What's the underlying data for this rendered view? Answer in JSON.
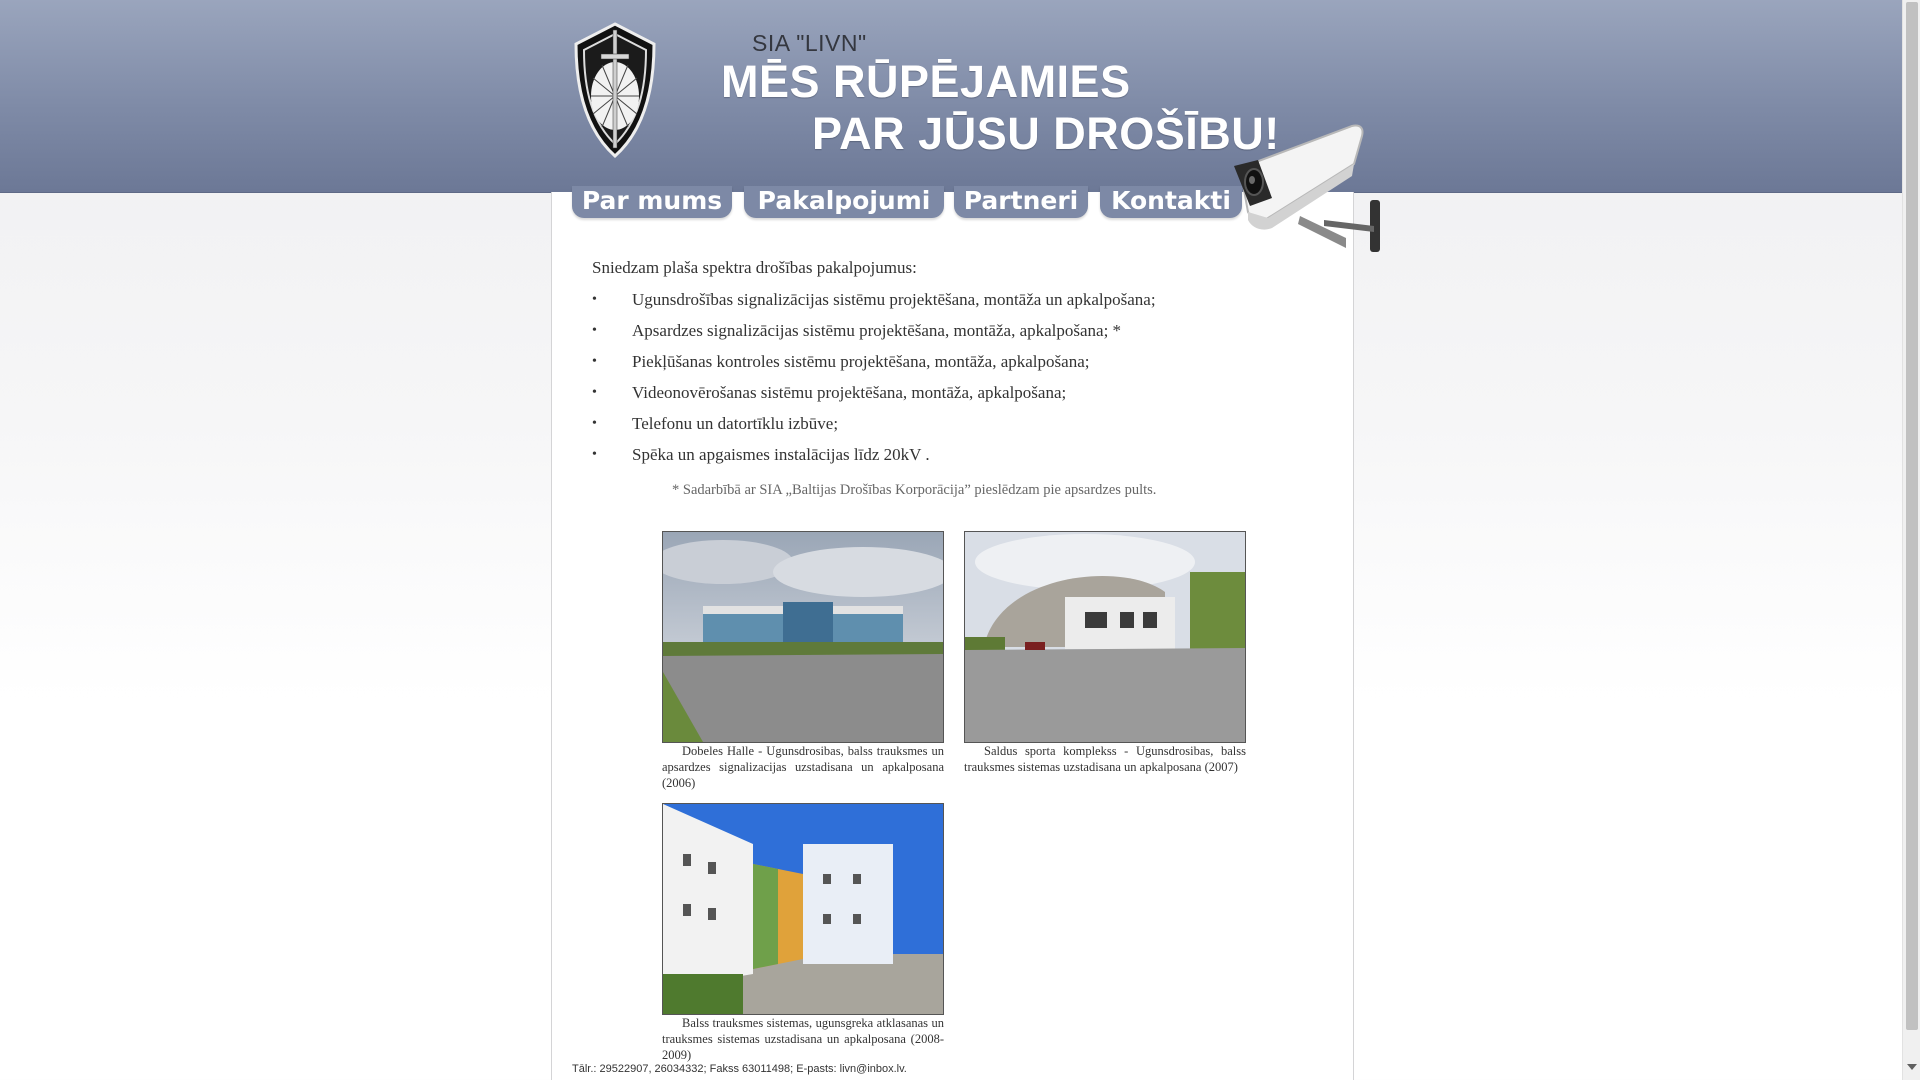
{
  "header": {
    "company": "SIA \"LIVN\"",
    "slogan_line1": "MĒS RŪPĒJAMIES",
    "slogan_line2": "PAR JŪSU DROŠĪBU!"
  },
  "nav": {
    "items": [
      {
        "label": "Par mums"
      },
      {
        "label": "Pakalpojumi"
      },
      {
        "label": "Partneri"
      },
      {
        "label": "Kontakti"
      }
    ]
  },
  "content": {
    "intro": "Sniedzam plaša spektra drošības pakalpojumus:",
    "bullet_glyph": "•",
    "services": [
      "Ugunsdrošības signalizācijas sistēmu projektēšana, montāža un apkalpošana;",
      "Apsardzes signalizācijas sistēmu projektēšana, montāža, apkalpošana; *",
      "Piekļūšanas kontroles sistēmu projektēšana, montāža, apkalpošana;",
      "Videonovērošanas sistēmu projektēšana, montāža, apkalpošana;",
      "Telefonu un datortīklu izbūve;",
      "Spēka un apgaismes instalācijas līdz 20kV ."
    ],
    "note": "* Sadarbībā ar SIA „Baltijas Drošības Korporācija” pieslēdzam pie apsardzes pults."
  },
  "gallery": [
    {
      "caption": "Dobeles Halle - Ugunsdrosibas, balss trauksmes un apsardzes signalizacijas uzstadisana un apkalposana (2006)"
    },
    {
      "caption": "Saldus sporta komplekss - Ugunsdrosibas, balss trauksmes sistemas uzstadisana un apkalposana (2007)"
    },
    {
      "caption": "Balss trauksmes sistemas, ugunsgreka atklasanas un trauksmes sistemas uzstadisana un apkalposana (2008-2009)"
    }
  ],
  "footer": {
    "text": "Tālr.: 29522907, 26034332; Fakss 63011498; E-pasts: livn@inbox.lv."
  },
  "colors": {
    "header_top": "#9aa5bd",
    "header_bottom": "#6c7896",
    "nav_tab": "#7d89a6",
    "body_text": "#333333"
  }
}
